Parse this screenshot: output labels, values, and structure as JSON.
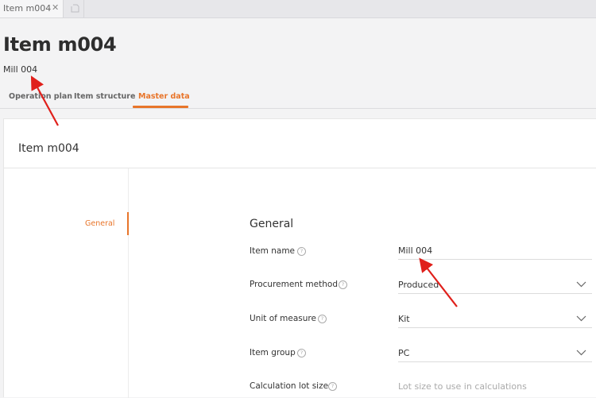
{
  "window_tab": {
    "label": "Item m004",
    "close_glyph": "✕"
  },
  "header": {
    "title": "Item m004",
    "subtitle": "Mill 004"
  },
  "tabs": [
    {
      "label": "Operation plan"
    },
    {
      "label": "Item structure"
    },
    {
      "label": "Master data",
      "active": true
    }
  ],
  "card": {
    "title": "Item m004",
    "nav": [
      {
        "label": "General",
        "active": true
      }
    ],
    "section_title": "General",
    "fields": [
      {
        "label": "Item name",
        "value": "Mill 004",
        "type": "text"
      },
      {
        "label": "Procurement method",
        "value": "Produced",
        "type": "select"
      },
      {
        "label": "Unit of measure",
        "value": "Kit",
        "type": "select"
      },
      {
        "label": "Item group",
        "value": "PC",
        "type": "select"
      },
      {
        "label": "Calculation lot size",
        "value": "",
        "placeholder": "Lot size to use in calculations",
        "type": "text"
      }
    ]
  },
  "help_glyph": "?",
  "colors": {
    "accent": "#e8752a",
    "annotation_arrow": "#e0201b"
  },
  "icons": [
    "close-icon",
    "new-tab-icon",
    "help-icon",
    "chevron-down-icon",
    "annotation-arrow"
  ]
}
